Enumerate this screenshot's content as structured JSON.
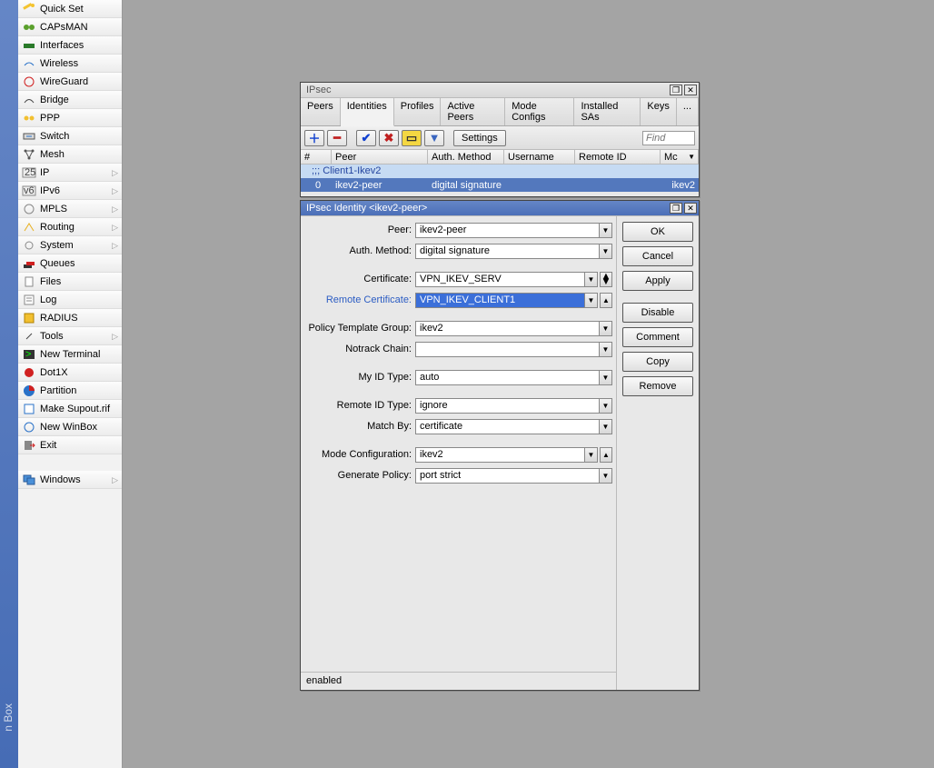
{
  "sidebar": {
    "groups": [
      [
        {
          "label": "Quick Set",
          "icon": "wand",
          "submenu": false
        },
        {
          "label": "CAPsMAN",
          "icon": "caps",
          "submenu": false
        },
        {
          "label": "Interfaces",
          "icon": "iface",
          "submenu": false
        },
        {
          "label": "Wireless",
          "icon": "wifi",
          "submenu": false
        },
        {
          "label": "WireGuard",
          "icon": "wg",
          "submenu": false
        },
        {
          "label": "Bridge",
          "icon": "bridge",
          "submenu": false
        },
        {
          "label": "PPP",
          "icon": "ppp",
          "submenu": false
        },
        {
          "label": "Switch",
          "icon": "switch",
          "submenu": false
        },
        {
          "label": "Mesh",
          "icon": "mesh",
          "submenu": false
        },
        {
          "label": "IP",
          "icon": "ip",
          "submenu": true
        },
        {
          "label": "IPv6",
          "icon": "ipv6",
          "submenu": true
        },
        {
          "label": "MPLS",
          "icon": "mpls",
          "submenu": true
        },
        {
          "label": "Routing",
          "icon": "routing",
          "submenu": true
        },
        {
          "label": "System",
          "icon": "system",
          "submenu": true
        },
        {
          "label": "Queues",
          "icon": "queues",
          "submenu": false
        },
        {
          "label": "Files",
          "icon": "files",
          "submenu": false
        },
        {
          "label": "Log",
          "icon": "log",
          "submenu": false
        },
        {
          "label": "RADIUS",
          "icon": "radius",
          "submenu": false
        },
        {
          "label": "Tools",
          "icon": "tools",
          "submenu": true
        },
        {
          "label": "New Terminal",
          "icon": "term",
          "submenu": false
        },
        {
          "label": "Dot1X",
          "icon": "dot1x",
          "submenu": false
        },
        {
          "label": "Partition",
          "icon": "part",
          "submenu": false
        },
        {
          "label": "Make Supout.rif",
          "icon": "supout",
          "submenu": false
        },
        {
          "label": "New WinBox",
          "icon": "winbox",
          "submenu": false
        },
        {
          "label": "Exit",
          "icon": "exit",
          "submenu": false
        }
      ],
      [
        {
          "label": "Windows",
          "icon": "windows",
          "submenu": true
        }
      ]
    ]
  },
  "ipsec_win": {
    "title": "IPsec",
    "tabs": [
      "Peers",
      "Identities",
      "Profiles",
      "Active Peers",
      "Mode Configs",
      "Installed SAs",
      "Keys",
      "..."
    ],
    "active_tab": "Identities",
    "settings_label": "Settings",
    "find_placeholder": "Find",
    "columns": {
      "num": "#",
      "peer": "Peer",
      "auth": "Auth. Method",
      "user": "Username",
      "remote": "Remote ID",
      "mode": "Mc"
    },
    "comment_row": ";;; Client1-Ikev2",
    "row": {
      "num": "0",
      "peer": "ikev2-peer",
      "auth": "digital signature",
      "user": "",
      "remote": "",
      "mode": "ikev2"
    }
  },
  "detail_win": {
    "title": "IPsec Identity <ikev2-peer>",
    "status": "enabled",
    "buttons": {
      "ok": "OK",
      "cancel": "Cancel",
      "apply": "Apply",
      "disable": "Disable",
      "comment": "Comment",
      "copy": "Copy",
      "remove": "Remove"
    },
    "labels": {
      "peer": "Peer:",
      "auth": "Auth. Method:",
      "cert": "Certificate:",
      "rcert": "Remote Certificate:",
      "ptg": "Policy Template Group:",
      "notrack": "Notrack Chain:",
      "myid": "My ID Type:",
      "remid": "Remote ID Type:",
      "match": "Match By:",
      "mode": "Mode Configuration:",
      "gen": "Generate Policy:"
    },
    "values": {
      "peer": "ikev2-peer",
      "auth": "digital signature",
      "cert": "VPN_IKEV_SERV",
      "rcert": "VPN_IKEV_CLIENT1",
      "ptg": "ikev2",
      "notrack": "",
      "myid": "auto",
      "remid": "ignore",
      "match": "certificate",
      "mode": "ikev2",
      "gen": "port strict"
    }
  },
  "app_label": "n Box"
}
